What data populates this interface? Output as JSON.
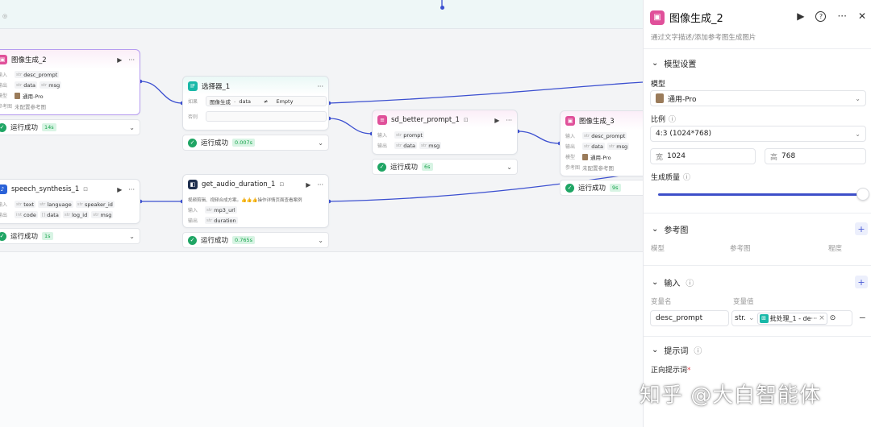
{
  "colors": {
    "accent": "#3d4fc9",
    "success": "#1fa564",
    "image_icon": "#e0509a",
    "if_icon": "#19b8a8",
    "prompt_icon": "#e0509a",
    "speech_icon": "#2a62d8",
    "audio_icon": "#1f2f4f"
  },
  "nodes": {
    "img2": {
      "title": "图像生成_2",
      "in_label": "输入",
      "in1": "desc_prompt",
      "in1_type": "str",
      "out_label": "输出",
      "out1": "data",
      "out1_type": "str",
      "out2": "msg",
      "out2_type": "str",
      "model_label": "模型",
      "model": "通用-Pro",
      "ref_label": "参考图",
      "ref": "未配置参考图",
      "status": "运行成功",
      "time": "14s"
    },
    "selector": {
      "title": "选择器_1",
      "if_label": "如果",
      "cond_a": "图像生成",
      "cond_sep": "-",
      "cond_b": "data",
      "op": "≠",
      "cond_val": "Empty",
      "else_label": "否则",
      "status": "运行成功",
      "time": "0.007s"
    },
    "sdp": {
      "title": "sd_better_prompt_1",
      "in_label": "输入",
      "in1": "prompt",
      "in1_type": "str",
      "out_label": "输出",
      "out1": "data",
      "out1_type": "str",
      "out2": "msg",
      "out2_type": "str",
      "status": "运行成功",
      "time": "6s"
    },
    "img3": {
      "title": "图像生成_3",
      "in_label": "输入",
      "in1": "desc_prompt",
      "in1_type": "str",
      "out_label": "输出",
      "out1": "data",
      "out1_type": "str",
      "out2": "msg",
      "out2_type": "str",
      "model_label": "模型",
      "model": "通用-Pro",
      "ref_label": "参考图",
      "ref": "未配置参考图",
      "status": "运行成功",
      "time": "9s"
    },
    "speech": {
      "title": "speech_synthesis_1",
      "in_label": "输入",
      "in1": "text",
      "in1_type": "str",
      "in2": "language",
      "in2_type": "str",
      "in3": "speaker_id",
      "in3_type": "str",
      "out_label": "输出",
      "out1": "code",
      "out1_type": "int",
      "out2": "data",
      "out2_type": "[]",
      "out3": "log_id",
      "out3_type": "str",
      "out4": "msg",
      "out4_type": "str",
      "status": "运行成功",
      "time": "1s"
    },
    "audio": {
      "title": "get_audio_duration_1",
      "desc": "视频剪辑、视频合成方案。👍👍👍操作详情页面查看案例",
      "in_label": "输入",
      "in1": "mp3_url",
      "in1_type": "str",
      "out_label": "输出",
      "out1": "duration",
      "out1_type": "str",
      "status": "运行成功",
      "time": "0.765s"
    }
  },
  "panel": {
    "title": "图像生成_2",
    "desc": "通过文字描述/添加参考图生成图片",
    "model_section": "模型设置",
    "model_label": "模型",
    "model_value": "通用-Pro",
    "ratio_label": "比例",
    "ratio_value": "4:3 (1024*768)",
    "width_label": "宽",
    "width_value": "1024",
    "height_label": "高",
    "height_value": "768",
    "quality_label": "生成质量",
    "quality_level": 0.99,
    "ref_section": "参考图",
    "ref_col1": "模型",
    "ref_col2": "参考图",
    "ref_col3": "程度",
    "input_section": "输入",
    "var_name_label": "变量名",
    "var_value_label": "变量值",
    "var_name": "desc_prompt",
    "var_type": "str.",
    "var_ref": "批处理_1 - de···",
    "prompt_section": "提示词",
    "positive_label": "正向提示词"
  },
  "watermark": "知乎 @大白智能体"
}
